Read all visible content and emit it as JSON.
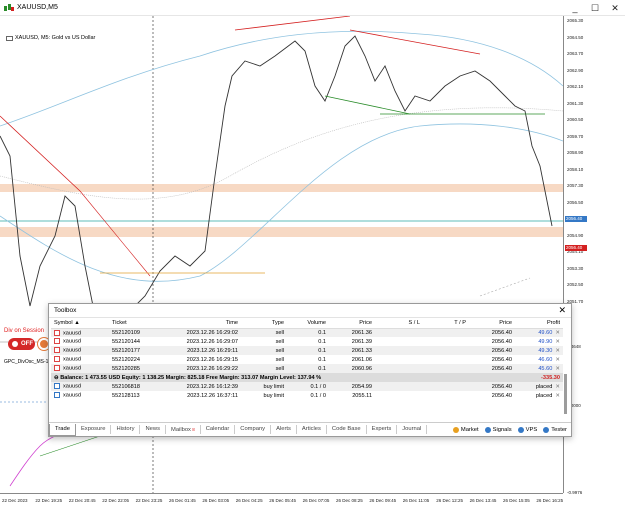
{
  "window": {
    "title": "XAUUSD,M5"
  },
  "chart": {
    "symbol_label": "XAUUSD, M5:  Gold vs US Dollar",
    "session_label": "Div on Session",
    "off_button": "OFF",
    "indicator_label": "GPC_DivOsc_MS-1",
    "price_ticks": [
      "2065.30",
      "2064.50",
      "2063.70",
      "2062.90",
      "2062.10",
      "2061.30",
      "2060.50",
      "2059.70",
      "2058.90",
      "2058.10",
      "2057.30",
      "2056.50",
      "2055.70",
      "2054.90",
      "2054.10",
      "2053.30",
      "2052.50",
      "2051.70"
    ],
    "current_price": "2056.40",
    "bid_price": "2056.40",
    "indicator_ticks": [
      "9.4648",
      "0.0000",
      "-0.9976"
    ],
    "time_ticks": [
      "22 Dec 2023",
      "22 Dec 19:25",
      "22 Dec 20:45",
      "22 Dec 22:05",
      "22 Dec 23:25",
      "26 Dec 01:45",
      "26 Dec 03:05",
      "26 Dec 04:25",
      "26 Dec 05:45",
      "26 Dec 07:05",
      "26 Dec 08:25",
      "26 Dec 09:45",
      "26 Dec 11:05",
      "26 Dec 12:25",
      "26 Dec 13:45",
      "26 Dec 15:05",
      "26 Dec 16:25"
    ]
  },
  "toolbox": {
    "title": "Toolbox",
    "columns": [
      "Symbol",
      "Ticket",
      "Time",
      "Type",
      "Volume",
      "Price",
      "S / L",
      "T / P",
      "Price",
      "Profit"
    ],
    "positions": [
      {
        "symbol": "xauusd",
        "ticket": "552120109",
        "time": "2023.12.26 16:29:02",
        "type": "sell",
        "volume": "0.1",
        "price": "2061.36",
        "sl": "",
        "tp": "",
        "cur": "2056.40",
        "profit": "49.60"
      },
      {
        "symbol": "xauusd",
        "ticket": "552120144",
        "time": "2023.12.26 16:29:07",
        "type": "sell",
        "volume": "0.1",
        "price": "2061.39",
        "sl": "",
        "tp": "",
        "cur": "2056.40",
        "profit": "49.90"
      },
      {
        "symbol": "xauusd",
        "ticket": "552120177",
        "time": "2023.12.26 16:29:11",
        "type": "sell",
        "volume": "0.1",
        "price": "2061.33",
        "sl": "",
        "tp": "",
        "cur": "2056.40",
        "profit": "49.30"
      },
      {
        "symbol": "xauusd",
        "ticket": "552120224",
        "time": "2023.12.26 16:29:15",
        "type": "sell",
        "volume": "0.1",
        "price": "2061.06",
        "sl": "",
        "tp": "",
        "cur": "2056.40",
        "profit": "46.60"
      },
      {
        "symbol": "xauusd",
        "ticket": "552120285",
        "time": "2023.12.26 16:29:22",
        "type": "sell",
        "volume": "0.1",
        "price": "2060.96",
        "sl": "",
        "tp": "",
        "cur": "2056.40",
        "profit": "45.60"
      }
    ],
    "balance_text": "Balance: 1 473.55 USD  Equity: 1 138.25  Margin: 825.18  Free Margin: 313.07  Margin Level: 137.94 %",
    "balance_profit": "-335.30",
    "orders": [
      {
        "symbol": "xauusd",
        "ticket": "552106818",
        "time": "2023.12.26 16:12:39",
        "type": "buy limit",
        "volume": "0.1 / 0",
        "price": "2054.99",
        "sl": "",
        "tp": "",
        "cur": "2056.40",
        "profit": "placed"
      },
      {
        "symbol": "xauusd",
        "ticket": "552128113",
        "time": "2023.12.26 16:37:11",
        "type": "buy limit",
        "volume": "0.1 / 0",
        "price": "2055.11",
        "sl": "",
        "tp": "",
        "cur": "2056.40",
        "profit": "placed"
      }
    ],
    "tabs": [
      "Trade",
      "Exposure",
      "History",
      "News",
      "Mailbox",
      "Calendar",
      "Company",
      "Alerts",
      "Articles",
      "Code Base",
      "Experts",
      "Journal"
    ],
    "mailbox_badge": "8",
    "right_tabs": [
      "Market",
      "Signals",
      "VPS",
      "Tester"
    ]
  },
  "colors": {
    "bull": "#2a8c2a",
    "bear": "#d42020",
    "bands": "#8fc3e0",
    "zone": "#f7d9c4",
    "accent": "#3478c6"
  }
}
